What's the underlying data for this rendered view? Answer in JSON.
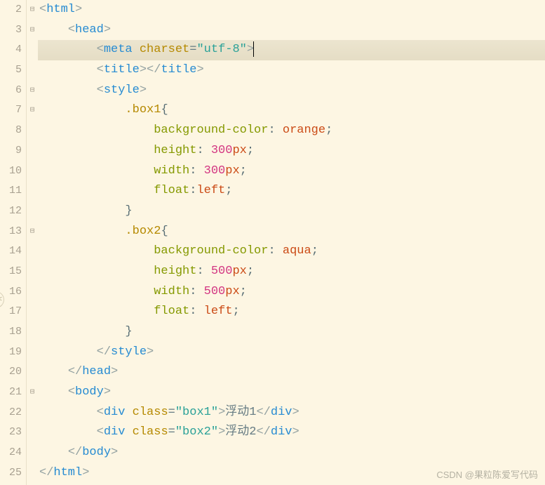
{
  "gutter": {
    "numbers": [
      "2",
      "3",
      "4",
      "5",
      "6",
      "7",
      "8",
      "9",
      "10",
      "11",
      "12",
      "13",
      "14",
      "15",
      "16",
      "17",
      "18",
      "19",
      "20",
      "21",
      "22",
      "23",
      "24",
      "25"
    ],
    "folds": [
      "⊟",
      "⊟",
      "",
      "",
      "⊟",
      "⊟",
      "",
      "",
      "",
      "",
      "",
      "⊟",
      "",
      "",
      "",
      "",
      "",
      "",
      "",
      "⊟",
      "",
      "",
      "",
      ""
    ]
  },
  "code": {
    "l2": {
      "indent": "",
      "tag": "html"
    },
    "l3": {
      "indent": "    ",
      "tag": "head"
    },
    "l4": {
      "indent": "        ",
      "tag": "meta",
      "attr": "charset",
      "val": "\"utf-8\""
    },
    "l5": {
      "indent": "        ",
      "tag": "title"
    },
    "l6": {
      "indent": "        ",
      "tag": "style"
    },
    "l7": {
      "indent": "            ",
      "sel": ".box1",
      "brace": "{"
    },
    "l8": {
      "indent": "                ",
      "prop": "background-color",
      "val": "orange"
    },
    "l9": {
      "indent": "                ",
      "prop": "height",
      "num": "300",
      "unit": "px"
    },
    "l10": {
      "indent": "                ",
      "prop": "width",
      "num": "300",
      "unit": "px"
    },
    "l11": {
      "indent": "                ",
      "prop": "float",
      "val": "left"
    },
    "l12": {
      "indent": "            ",
      "brace": "}"
    },
    "l13": {
      "indent": "            ",
      "sel": ".box2",
      "brace": "{"
    },
    "l14": {
      "indent": "                ",
      "prop": "background-color",
      "val": "aqua"
    },
    "l15": {
      "indent": "                ",
      "prop": "height",
      "num": "500",
      "unit": "px"
    },
    "l16": {
      "indent": "                ",
      "prop": "width",
      "num": "500",
      "unit": "px"
    },
    "l17": {
      "indent": "                ",
      "prop": "float",
      "val": "left"
    },
    "l18": {
      "indent": "            ",
      "brace": "}"
    },
    "l19": {
      "indent": "        ",
      "tag": "style"
    },
    "l20": {
      "indent": "    ",
      "tag": "head"
    },
    "l21": {
      "indent": "    ",
      "tag": "body"
    },
    "l22": {
      "indent": "        ",
      "tag": "div",
      "attr": "class",
      "val": "\"box1\"",
      "text": "浮动1"
    },
    "l23": {
      "indent": "        ",
      "tag": "div",
      "attr": "class",
      "val": "\"box2\"",
      "text": "浮动2"
    },
    "l24": {
      "indent": "    ",
      "tag": "body"
    },
    "l25": {
      "indent": "",
      "tag": "html"
    }
  },
  "watermark": "CSDN @果粒陈爱写代码",
  "edge_handle": "<"
}
